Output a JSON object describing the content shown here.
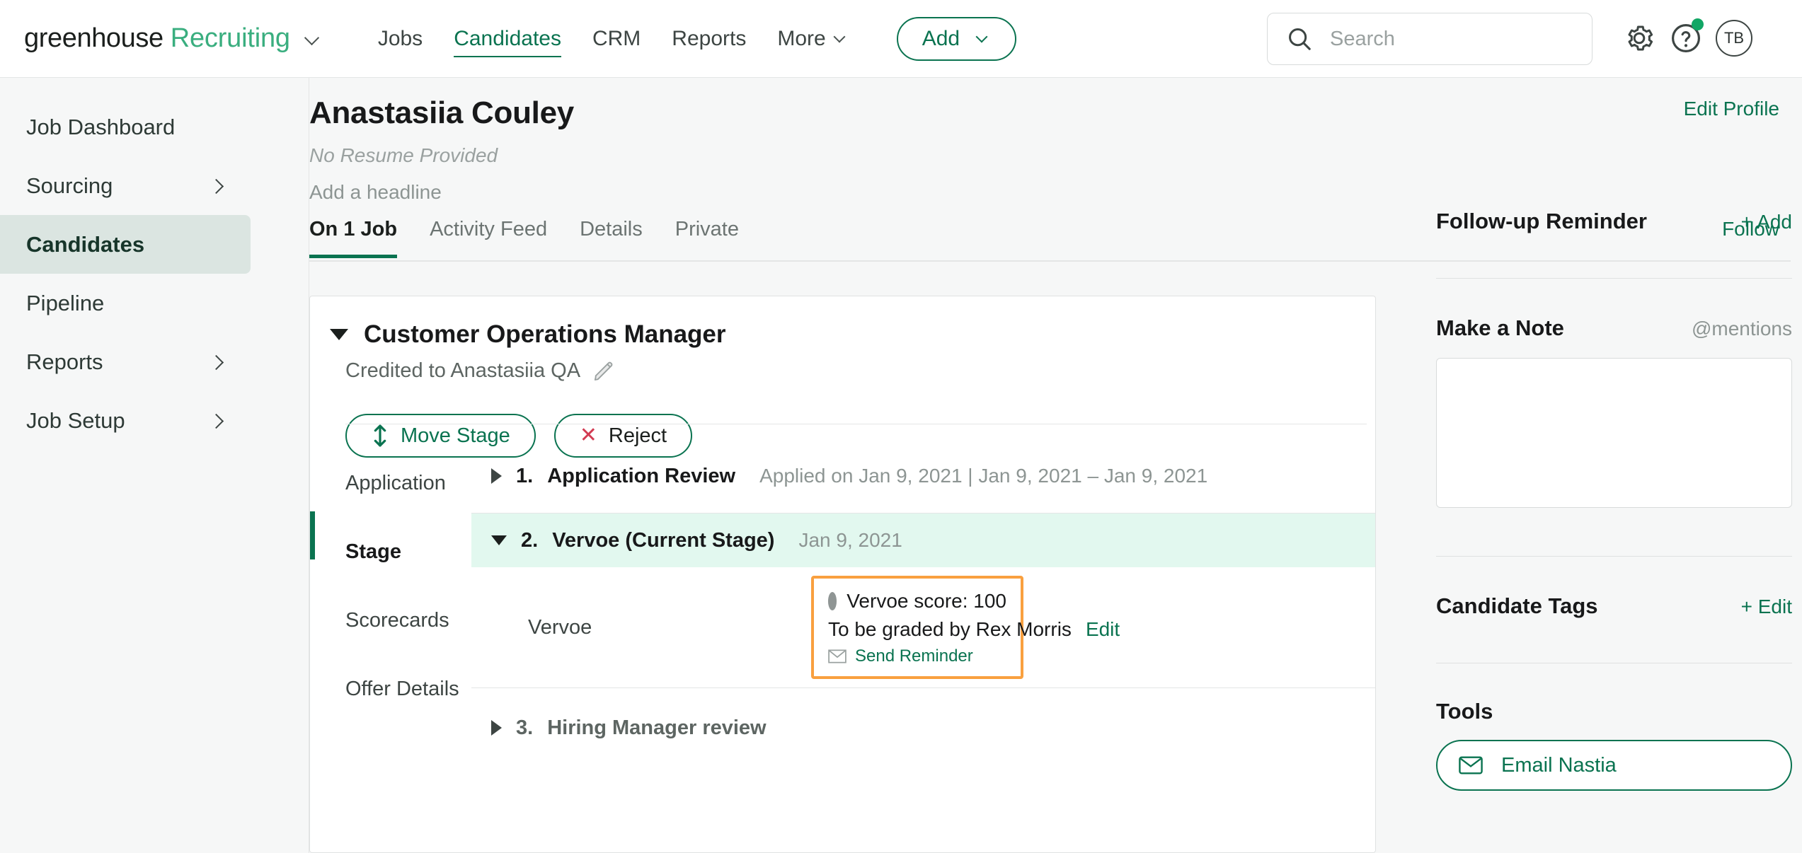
{
  "brand": {
    "name": "greenhouse",
    "product": "Recruiting"
  },
  "topnav": {
    "links": [
      {
        "label": "Jobs",
        "active": false
      },
      {
        "label": "Candidates",
        "active": true
      },
      {
        "label": "CRM",
        "active": false
      },
      {
        "label": "Reports",
        "active": false
      },
      {
        "label": "More",
        "active": false
      }
    ],
    "add_label": "Add",
    "search_placeholder": "Search",
    "avatar_initials": "TB"
  },
  "sidebar": {
    "items": [
      {
        "label": "Job Dashboard",
        "chevron": false,
        "active": false
      },
      {
        "label": "Sourcing",
        "chevron": true,
        "active": false
      },
      {
        "label": "Candidates",
        "chevron": false,
        "active": true
      },
      {
        "label": "Pipeline",
        "chevron": false,
        "active": false
      },
      {
        "label": "Reports",
        "chevron": true,
        "active": false
      },
      {
        "label": "Job Setup",
        "chevron": true,
        "active": false
      }
    ]
  },
  "candidate": {
    "name": "Anastasiia Couley",
    "resume_status": "No Resume Provided",
    "headline_placeholder": "Add a headline",
    "edit_profile_label": "Edit Profile",
    "follow_label": "Follow"
  },
  "tabs": [
    {
      "label": "On 1 Job",
      "active": true
    },
    {
      "label": "Activity Feed",
      "active": false
    },
    {
      "label": "Details",
      "active": false
    },
    {
      "label": "Private",
      "active": false
    }
  ],
  "job": {
    "title": "Customer Operations Manager",
    "credited_to": "Credited to Anastasiia QA",
    "move_stage_label": "Move Stage",
    "reject_label": "Reject",
    "subnav": [
      {
        "label": "Application",
        "active": false
      },
      {
        "label": "Stage",
        "active": true
      },
      {
        "label": "Scorecards",
        "active": false
      },
      {
        "label": "Offer Details",
        "active": false
      }
    ],
    "stages": [
      {
        "number": "1.",
        "name": "Application Review",
        "meta": "Applied on Jan 9, 2021 | Jan 9, 2021 – Jan 9, 2021",
        "expanded": false,
        "current": false
      },
      {
        "number": "2.",
        "name": "Vervoe (Current Stage)",
        "meta": "Jan 9, 2021",
        "expanded": true,
        "current": true
      },
      {
        "number": "3.",
        "name": "Hiring Manager review",
        "meta": "",
        "expanded": false,
        "current": false
      }
    ],
    "interview": {
      "label": "Vervoe",
      "score_text": "Vervoe score: 100",
      "graded_by": "To be graded by Rex Morris",
      "edit_label": "Edit",
      "send_reminder_label": "Send Reminder"
    }
  },
  "rail": {
    "followup": {
      "title": "Follow-up Reminder",
      "action": "+ Add"
    },
    "note": {
      "title": "Make a Note",
      "mentions": "@mentions"
    },
    "tags": {
      "title": "Candidate Tags",
      "action": "+ Edit"
    },
    "tools": {
      "title": "Tools",
      "email_label": "Email Nastia"
    }
  },
  "colors": {
    "green": "#0a7350",
    "brand_green": "#3aae7f",
    "orange_highlight": "#f9a03f",
    "reject_red": "#d23b52",
    "current_stage_bg": "#e2f8ef",
    "sidebar_active_bg": "#dbe5e1"
  }
}
